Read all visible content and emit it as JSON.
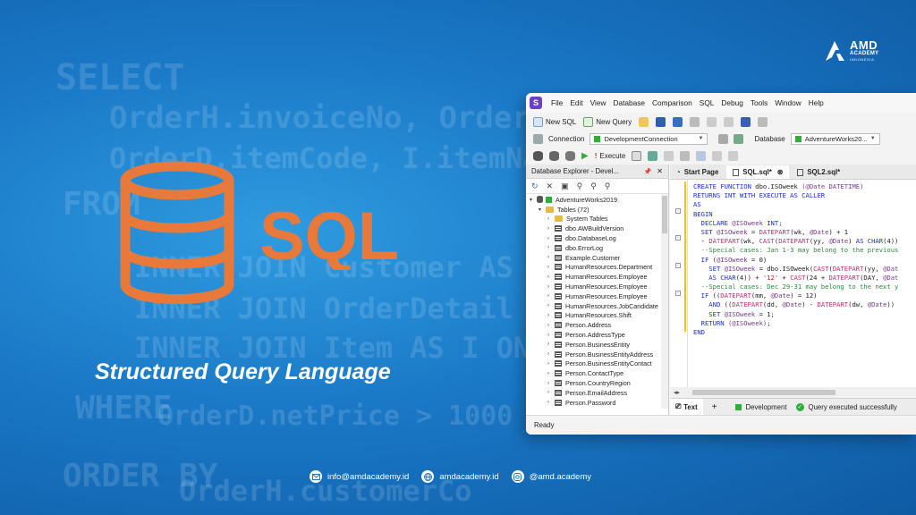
{
  "background": {
    "code_lines": [
      "SELECT",
      "OrderH.invoiceNo, OrderH.",
      "OrderD.itemCode, I.itemNa",
      "FROM",
      "INNER JOIN Customer AS",
      "INNER JOIN OrderDetail",
      "INNER JOIN Item AS I ON",
      "WHERE",
      "OrderD.netPrice > 1000",
      "ORDER BY",
      "OrderH.customerCo"
    ]
  },
  "brand": {
    "name": "AMD",
    "line2": "ACADEMY",
    "line3": "INDONESIA"
  },
  "hero": {
    "logo_text": "SQL",
    "tagline": "Structured Query Language",
    "accent": "#e8793a"
  },
  "contacts": [
    {
      "icon": "mail-icon",
      "text": "info@amdacademy.id"
    },
    {
      "icon": "globe-icon",
      "text": "amdacademy.id"
    },
    {
      "icon": "instagram-icon",
      "text": "@amd.academy"
    }
  ],
  "ide": {
    "menu": [
      "File",
      "Edit",
      "View",
      "Database",
      "Comparison",
      "SQL",
      "Debug",
      "Tools",
      "Window",
      "Help"
    ],
    "toolbar1": {
      "new_sql": "New SQL",
      "new_query": "New Query"
    },
    "toolbar2": {
      "connection_label": "Connection",
      "connection_value": "DevelopmentConnection",
      "database_label": "Database",
      "database_value": "AdventureWorks20..."
    },
    "toolbar3": {
      "execute": "Execute"
    },
    "explorer": {
      "title": "Database Explorer - Devel...",
      "tree": [
        {
          "label": "AdventureWorks2019",
          "kind": "db",
          "indent": 0
        },
        {
          "label": "Tables (72)",
          "kind": "folder",
          "indent": 1
        },
        {
          "label": "System Tables",
          "kind": "folder",
          "indent": 2
        },
        {
          "label": "dbo.AWBuildVersion",
          "kind": "table",
          "indent": 2
        },
        {
          "label": "dbo.DatabaseLog",
          "kind": "table",
          "indent": 2
        },
        {
          "label": "dbo.ErrorLog",
          "kind": "table",
          "indent": 2
        },
        {
          "label": "Example.Customer",
          "kind": "table",
          "indent": 2
        },
        {
          "label": "HumanResources.Department",
          "kind": "table",
          "indent": 2
        },
        {
          "label": "HumanResources.Employee",
          "kind": "table",
          "indent": 2
        },
        {
          "label": "HumanResources.Employee",
          "kind": "table",
          "indent": 2
        },
        {
          "label": "HumanResources.Employee",
          "kind": "table",
          "indent": 2
        },
        {
          "label": "HumanResources.JobCandidate",
          "kind": "table",
          "indent": 2
        },
        {
          "label": "HumanResources.Shift",
          "kind": "table",
          "indent": 2
        },
        {
          "label": "Person.Address",
          "kind": "table",
          "indent": 2
        },
        {
          "label": "Person.AddressType",
          "kind": "table",
          "indent": 2
        },
        {
          "label": "Person.BusinessEntity",
          "kind": "table",
          "indent": 2
        },
        {
          "label": "Person.BusinessEntityAddress",
          "kind": "table",
          "indent": 2
        },
        {
          "label": "Person.BusinessEntityContact",
          "kind": "table",
          "indent": 2
        },
        {
          "label": "Person.ContactType",
          "kind": "table",
          "indent": 2
        },
        {
          "label": "Person.CountryRegion",
          "kind": "table",
          "indent": 2
        },
        {
          "label": "Person.EmailAddress",
          "kind": "table",
          "indent": 2
        },
        {
          "label": "Person.Password",
          "kind": "table",
          "indent": 2
        }
      ]
    },
    "tabs": [
      {
        "label": "Start Page",
        "active": false
      },
      {
        "label": "SQL.sql*",
        "active": true
      },
      {
        "label": "SQL2.sql*",
        "active": false
      }
    ],
    "code": [
      [
        [
          "kw",
          "CREATE FUNCTION "
        ],
        [
          "nm",
          "dbo.ISOweek "
        ],
        [
          "var",
          "(@Date DATETIME)"
        ]
      ],
      [
        [
          "kw",
          "RETURNS INT WITH EXECUTE AS CALLER"
        ]
      ],
      [
        [
          "kw",
          "AS"
        ]
      ],
      [
        [
          "kw",
          "BEGIN"
        ]
      ],
      [
        [
          "kw",
          "  DECLARE "
        ],
        [
          "var",
          "@ISOweek "
        ],
        [
          "kw",
          "INT;"
        ]
      ],
      [
        [
          "kw",
          "  SET "
        ],
        [
          "var",
          "@ISOweek "
        ],
        [
          "nm",
          "= "
        ],
        [
          "fn",
          "DATEPART"
        ],
        [
          "nm",
          "(wk, "
        ],
        [
          "var",
          "@Date"
        ],
        [
          "nm",
          ") + 1"
        ]
      ],
      [
        [
          "nm",
          "  - "
        ],
        [
          "fn",
          "DATEPART"
        ],
        [
          "nm",
          "(wk, "
        ],
        [
          "fn",
          "CAST"
        ],
        [
          "nm",
          "("
        ],
        [
          "fn",
          "DATEPART"
        ],
        [
          "nm",
          "(yy, "
        ],
        [
          "var",
          "@Date"
        ],
        [
          "nm",
          ") "
        ],
        [
          "kw",
          "AS CHAR"
        ],
        [
          "nm",
          "(4))"
        ]
      ],
      [
        [
          "cm",
          "  --Special cases: Jan 1-3 may belong to the previous"
        ]
      ],
      [
        [
          "kw",
          "  IF "
        ],
        [
          "nm",
          "("
        ],
        [
          "var",
          "@ISOweek"
        ],
        [
          "nm",
          " = 0)"
        ]
      ],
      [
        [
          "kw",
          "    SET "
        ],
        [
          "var",
          "@ISOweek "
        ],
        [
          "nm",
          "= dbo.ISOweek("
        ],
        [
          "fn",
          "CAST"
        ],
        [
          "nm",
          "("
        ],
        [
          "fn",
          "DATEPART"
        ],
        [
          "nm",
          "(yy, "
        ],
        [
          "var",
          "@Dat"
        ]
      ],
      [
        [
          "kw",
          "    AS CHAR"
        ],
        [
          "nm",
          "(4)) + "
        ],
        [
          "str",
          "'12'"
        ],
        [
          "nm",
          " + "
        ],
        [
          "fn",
          "CAST"
        ],
        [
          "nm",
          "(24 + "
        ],
        [
          "fn",
          "DATEPART"
        ],
        [
          "nm",
          "(DAY, "
        ],
        [
          "var",
          "@Dat"
        ]
      ],
      [
        [
          "cm",
          "  --Special cases: Dec 29-31 may belong to the next y"
        ]
      ],
      [
        [
          "kw",
          "  IF "
        ],
        [
          "nm",
          "(("
        ],
        [
          "fn",
          "DATEPART"
        ],
        [
          "nm",
          "(mm, "
        ],
        [
          "var",
          "@Date"
        ],
        [
          "nm",
          ") = 12)"
        ]
      ],
      [
        [
          "kw",
          "    AND "
        ],
        [
          "nm",
          "(("
        ],
        [
          "fn",
          "DATEPART"
        ],
        [
          "nm",
          "(dd, "
        ],
        [
          "var",
          "@Date"
        ],
        [
          "nm",
          ") - "
        ],
        [
          "fn",
          "DATEPART"
        ],
        [
          "nm",
          "(dw, "
        ],
        [
          "var",
          "@Date"
        ],
        [
          "nm",
          "))"
        ]
      ],
      [
        [
          "kw",
          "    SET "
        ],
        [
          "var",
          "@ISOweek "
        ],
        [
          "nm",
          "= 1;"
        ]
      ],
      [
        [
          "kw",
          "  RETURN "
        ],
        [
          "var",
          "(@ISOweek)"
        ],
        [
          "nm",
          ";"
        ]
      ],
      [
        [
          "kw",
          "END"
        ]
      ]
    ],
    "bottom": {
      "text_tab": "Text",
      "plus": "+",
      "connection": "Development",
      "status": "Query executed successfully"
    },
    "status": "Ready"
  }
}
